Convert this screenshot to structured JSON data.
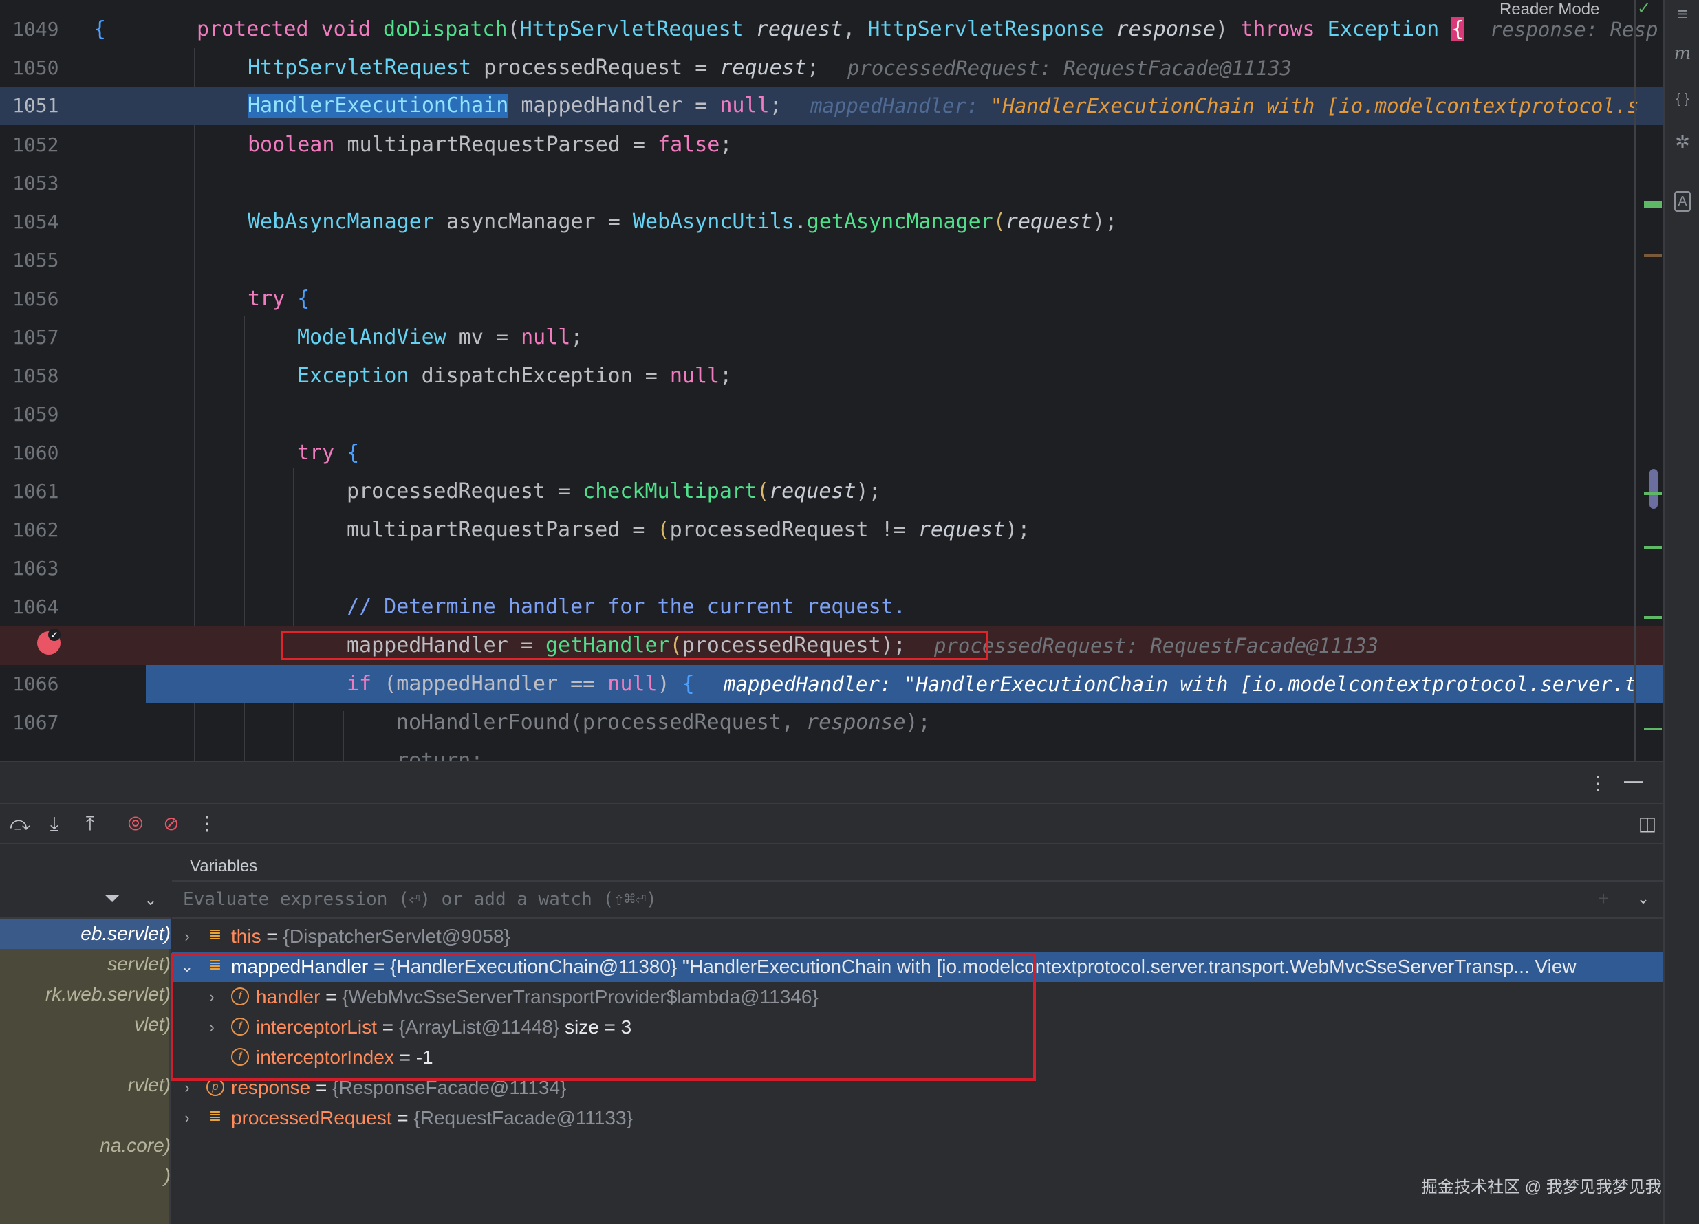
{
  "editor": {
    "reader_mode": "Reader Mode",
    "lines": [
      {
        "num": "1049"
      },
      {
        "num": "1050"
      },
      {
        "num": "1051"
      },
      {
        "num": "1052"
      },
      {
        "num": "1053"
      },
      {
        "num": "1054"
      },
      {
        "num": "1055"
      },
      {
        "num": "1056"
      },
      {
        "num": "1057"
      },
      {
        "num": "1058"
      },
      {
        "num": "1059"
      },
      {
        "num": "1060"
      },
      {
        "num": "1061"
      },
      {
        "num": "1062"
      },
      {
        "num": "1063"
      },
      {
        "num": "1064"
      },
      {
        "num": "1066"
      },
      {
        "num": "1067"
      }
    ],
    "code": {
      "l1049_a": "protected void ",
      "l1049_fn": "doDispatch",
      "l1049_b": "(",
      "l1049_t1": "HttpServletRequest",
      "l1049_p1": " request",
      "l1049_c": ", ",
      "l1049_t2": "HttpServletResponse",
      "l1049_p2": " response",
      "l1049_d": ") ",
      "l1049_kw": "throws ",
      "l1049_ex": "Exception ",
      "l1049_inlay": "response: Resp",
      "l1050_t": "HttpServletRequest",
      "l1050_rest": " processedRequest = ",
      "l1050_p": "request",
      "l1050_end": ";",
      "l1050_inlay": "processedRequest: RequestFacade@11133",
      "l1051_t": "HandlerExecutionChain",
      "l1051_rest": " mappedHandler = ",
      "l1051_kw": "null",
      "l1051_end": ";",
      "l1051_inlay_a": "mappedHandler: ",
      "l1051_inlay_b": "\"HandlerExecutionChain with [io.modelcontextprotocol.s",
      "l1052_kw": "boolean",
      "l1052_rest": " multipartRequestParsed = ",
      "l1052_kw2": "false",
      "l1052_end": ";",
      "l1054_t": "WebAsyncManager",
      "l1054_rest": " asyncManager = ",
      "l1054_t2": "WebAsyncUtils",
      "l1054_dot": ".",
      "l1054_fn": "getAsyncManager",
      "l1054_b": "(",
      "l1054_p": "request",
      "l1054_end": ");",
      "l1056_kw": "try ",
      "l1056_br": "{",
      "l1057_t": "ModelAndView",
      "l1057_rest": " mv = ",
      "l1057_kw": "null",
      "l1057_end": ";",
      "l1058_t": "Exception",
      "l1058_rest": " dispatchException = ",
      "l1058_kw": "null",
      "l1058_end": ";",
      "l1060_kw": "try ",
      "l1060_br": "{",
      "l1061_a": "processedRequest = ",
      "l1061_fn": "checkMultipart",
      "l1061_b": "(",
      "l1061_p": "request",
      "l1061_end": ");",
      "l1062_a": "multipartRequestParsed = ",
      "l1062_b": "(",
      "l1062_c": "processedRequest != ",
      "l1062_p": "request",
      "l1062_end": ");",
      "l1064_cm": "// Determine handler for the current request.",
      "l1065_a": "mappedHandler = ",
      "l1065_fn": "getHandler",
      "l1065_b": "(",
      "l1065_c": "processedRequest",
      "l1065_end": ");",
      "l1065_inlay": "processedRequest: RequestFacade@11133",
      "l1066_kw": "if ",
      "l1066_a": "(mappedHandler == ",
      "l1066_kw2": "null",
      "l1066_b": ") ",
      "l1066_br": "{",
      "l1066_inlay": "mappedHandler: \"HandlerExecutionChain with [io.modelcontextprotocol.server.t",
      "l1067_a": "noHandlerFound(processedRequest, ",
      "l1067_p": "response",
      "l1067_end": ");",
      "l1068_a": "return;"
    }
  },
  "debug": {
    "variables_title": "Variables",
    "eval_placeholder": "Evaluate expression (⏎) or add a watch (⇧⌘⏎)",
    "frames": [
      "eb.servlet)",
      "servlet)",
      "rk.web.servlet)",
      "vlet)",
      "rvlet)",
      "na.core)",
      ")"
    ],
    "vars": {
      "this_name": "this",
      "this_val": "{DispatcherServlet@9058}",
      "mh_name": "mappedHandler",
      "mh_val": "{HandlerExecutionChain@11380} \"HandlerExecutionChain with [io.modelcontextprotocol.server.transport.WebMvcSseServerTransp... View",
      "handler_name": "handler",
      "handler_val": "{WebMvcSseServerTransportProvider$lambda@11346}",
      "il_name": "interceptorList",
      "il_val": "{ArrayList@11448}",
      "il_size": "size = 3",
      "ii_name": "interceptorIndex",
      "ii_val": "-1",
      "resp_name": "response",
      "resp_val": "{ResponseFacade@11134}",
      "pr_name": "processedRequest",
      "pr_val": "{RequestFacade@11133}"
    }
  },
  "watermark": "掘金技术社区 @ 我梦见我梦见我"
}
